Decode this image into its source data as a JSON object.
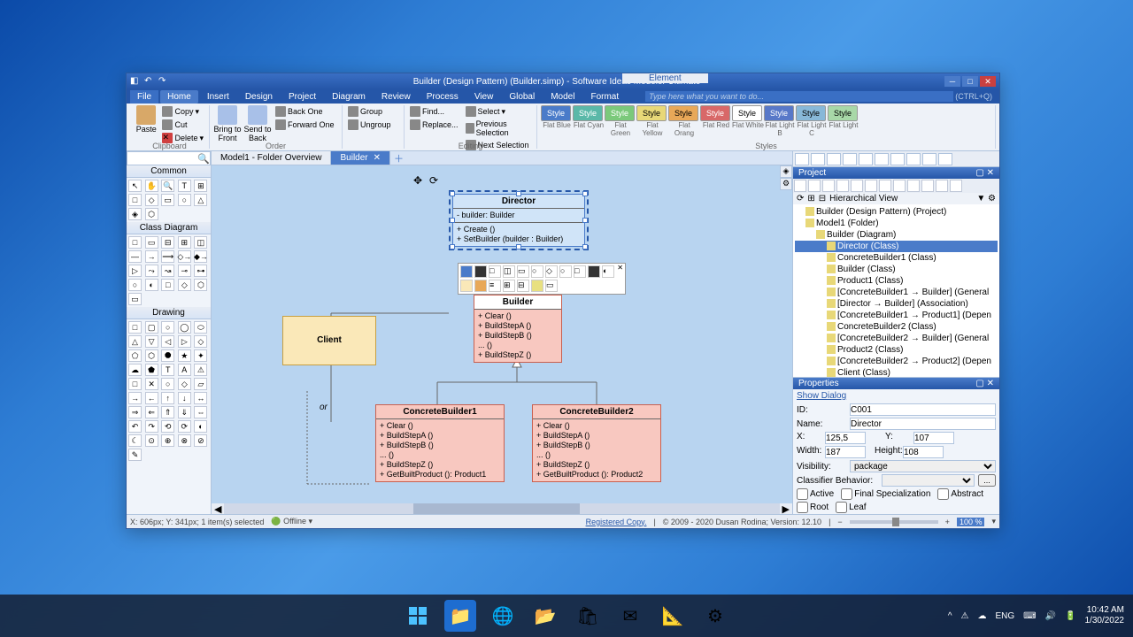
{
  "app": {
    "title": "Builder (Design Pattern) (Builder.simp) - Software Ideas Modeler Ultimate",
    "context_tab": "Element"
  },
  "menu": [
    "File",
    "Home",
    "Insert",
    "Design",
    "Project",
    "Diagram",
    "Review",
    "Process",
    "View",
    "Global",
    "Model",
    "Format"
  ],
  "menu_search_placeholder": "Type here what you want to do...",
  "menu_ctrl_hint": "(CTRL+Q)",
  "ribbon": {
    "paste": "Paste",
    "copy": "Copy",
    "cut": "Cut",
    "delete": "Delete",
    "bring_front": "Bring to Front",
    "send_back": "Send to Back",
    "back_one": "Back One",
    "forward_one": "Forward One",
    "group": "Group",
    "ungroup": "Ungroup",
    "find": "Find...",
    "replace": "Replace...",
    "select": "Select",
    "prev_sel": "Previous Selection",
    "next_sel": "Next Selection",
    "style": "Style",
    "flat_labels": [
      "Flat Blue",
      "Flat Cyan",
      "Flat Green",
      "Flat Yellow",
      "Flat Orang",
      "Flat Red",
      "Flat White",
      "Flat Light B",
      "Flat Light C",
      "Flat Light"
    ],
    "groups": {
      "clipboard": "Clipboard",
      "order": "Order",
      "editing": "Editing",
      "styles": "Styles"
    }
  },
  "palette": {
    "common": "Common",
    "class_diagram": "Class Diagram",
    "drawing": "Drawing"
  },
  "tabs": {
    "overview": "Model1 - Folder Overview",
    "builder": "Builder"
  },
  "diagram": {
    "director": {
      "name": "Director",
      "attr": "- builder: Builder",
      "op1": "+ Create ()",
      "op2": "+ SetBuilder (builder : Builder)"
    },
    "client": {
      "name": "Client"
    },
    "builder": {
      "name": "Builder",
      "op1": "+ Clear ()",
      "op2": "+ BuildStepA ()",
      "op3": "+ BuildStepB ()",
      "op4": "... ()",
      "op5": "+ BuildStepZ ()"
    },
    "cb1": {
      "name": "ConcreteBuilder1",
      "op1": "+ Clear ()",
      "op2": "+ BuildStepA ()",
      "op3": "+ BuildStepB ()",
      "op4": "... ()",
      "op5": "+ BuildStepZ ()",
      "op6": "+ GetBuiltProduct (): Product1"
    },
    "cb2": {
      "name": "ConcreteBuilder2",
      "op1": "+ Clear ()",
      "op2": "+ BuildStepA ()",
      "op3": "+ BuildStepB ()",
      "op4": "... ()",
      "op5": "+ BuildStepZ ()",
      "op6": "+ GetBuiltProduct (): Product2"
    },
    "or_label": "or"
  },
  "project_panel": {
    "title": "Project",
    "hier": "Hierarchical View",
    "tree": [
      {
        "l": 0,
        "label": "Builder (Design Pattern) (Project)"
      },
      {
        "l": 1,
        "label": "Model1 (Folder)"
      },
      {
        "l": 2,
        "label": "Builder (Diagram)"
      },
      {
        "l": 3,
        "label": "Director (Class)",
        "sel": true
      },
      {
        "l": 3,
        "label": "ConcreteBuilder1 (Class)"
      },
      {
        "l": 3,
        "label": "Builder (Class)"
      },
      {
        "l": 3,
        "label": "Product1 (Class)"
      },
      {
        "l": 3,
        "label": "[ConcreteBuilder1 → Builder] (General"
      },
      {
        "l": 3,
        "label": "[Director → Builder] (Association)"
      },
      {
        "l": 3,
        "label": "[ConcreteBuilder1 → Product1] (Depen"
      },
      {
        "l": 3,
        "label": "ConcreteBuilder2 (Class)"
      },
      {
        "l": 3,
        "label": "[ConcreteBuilder2 → Builder] (General"
      },
      {
        "l": 3,
        "label": "Product2 (Class)"
      },
      {
        "l": 3,
        "label": "[ConcreteBuilder2 → Product2] (Depen"
      },
      {
        "l": 3,
        "label": "Client (Class)"
      }
    ]
  },
  "props": {
    "title": "Properties",
    "show_dialog": "Show Dialog",
    "id_label": "ID:",
    "id": "C001",
    "name_label": "Name:",
    "name": "Director",
    "x_label": "X:",
    "x": "125,5",
    "y_label": "Y:",
    "y": "107",
    "w_label": "Width:",
    "w": "187",
    "h_label": "Height:",
    "h": "108",
    "vis_label": "Visibility:",
    "vis": "package",
    "cb_label": "Classifier Behavior:",
    "active": "Active",
    "final": "Final Specialization",
    "abstract": "Abstract",
    "root": "Root",
    "leaf": "Leaf"
  },
  "status": {
    "coords": "X: 606px; Y: 341px; 1 item(s) selected",
    "offline": "Offline",
    "reg": "Registered Copy.",
    "copyright": "© 2009 - 2020 Dusan Rodina; Version: 12.10",
    "zoom": "100 %"
  },
  "taskbar": {
    "lang": "ENG",
    "time": "10:42 AM",
    "date": "1/30/2022"
  }
}
